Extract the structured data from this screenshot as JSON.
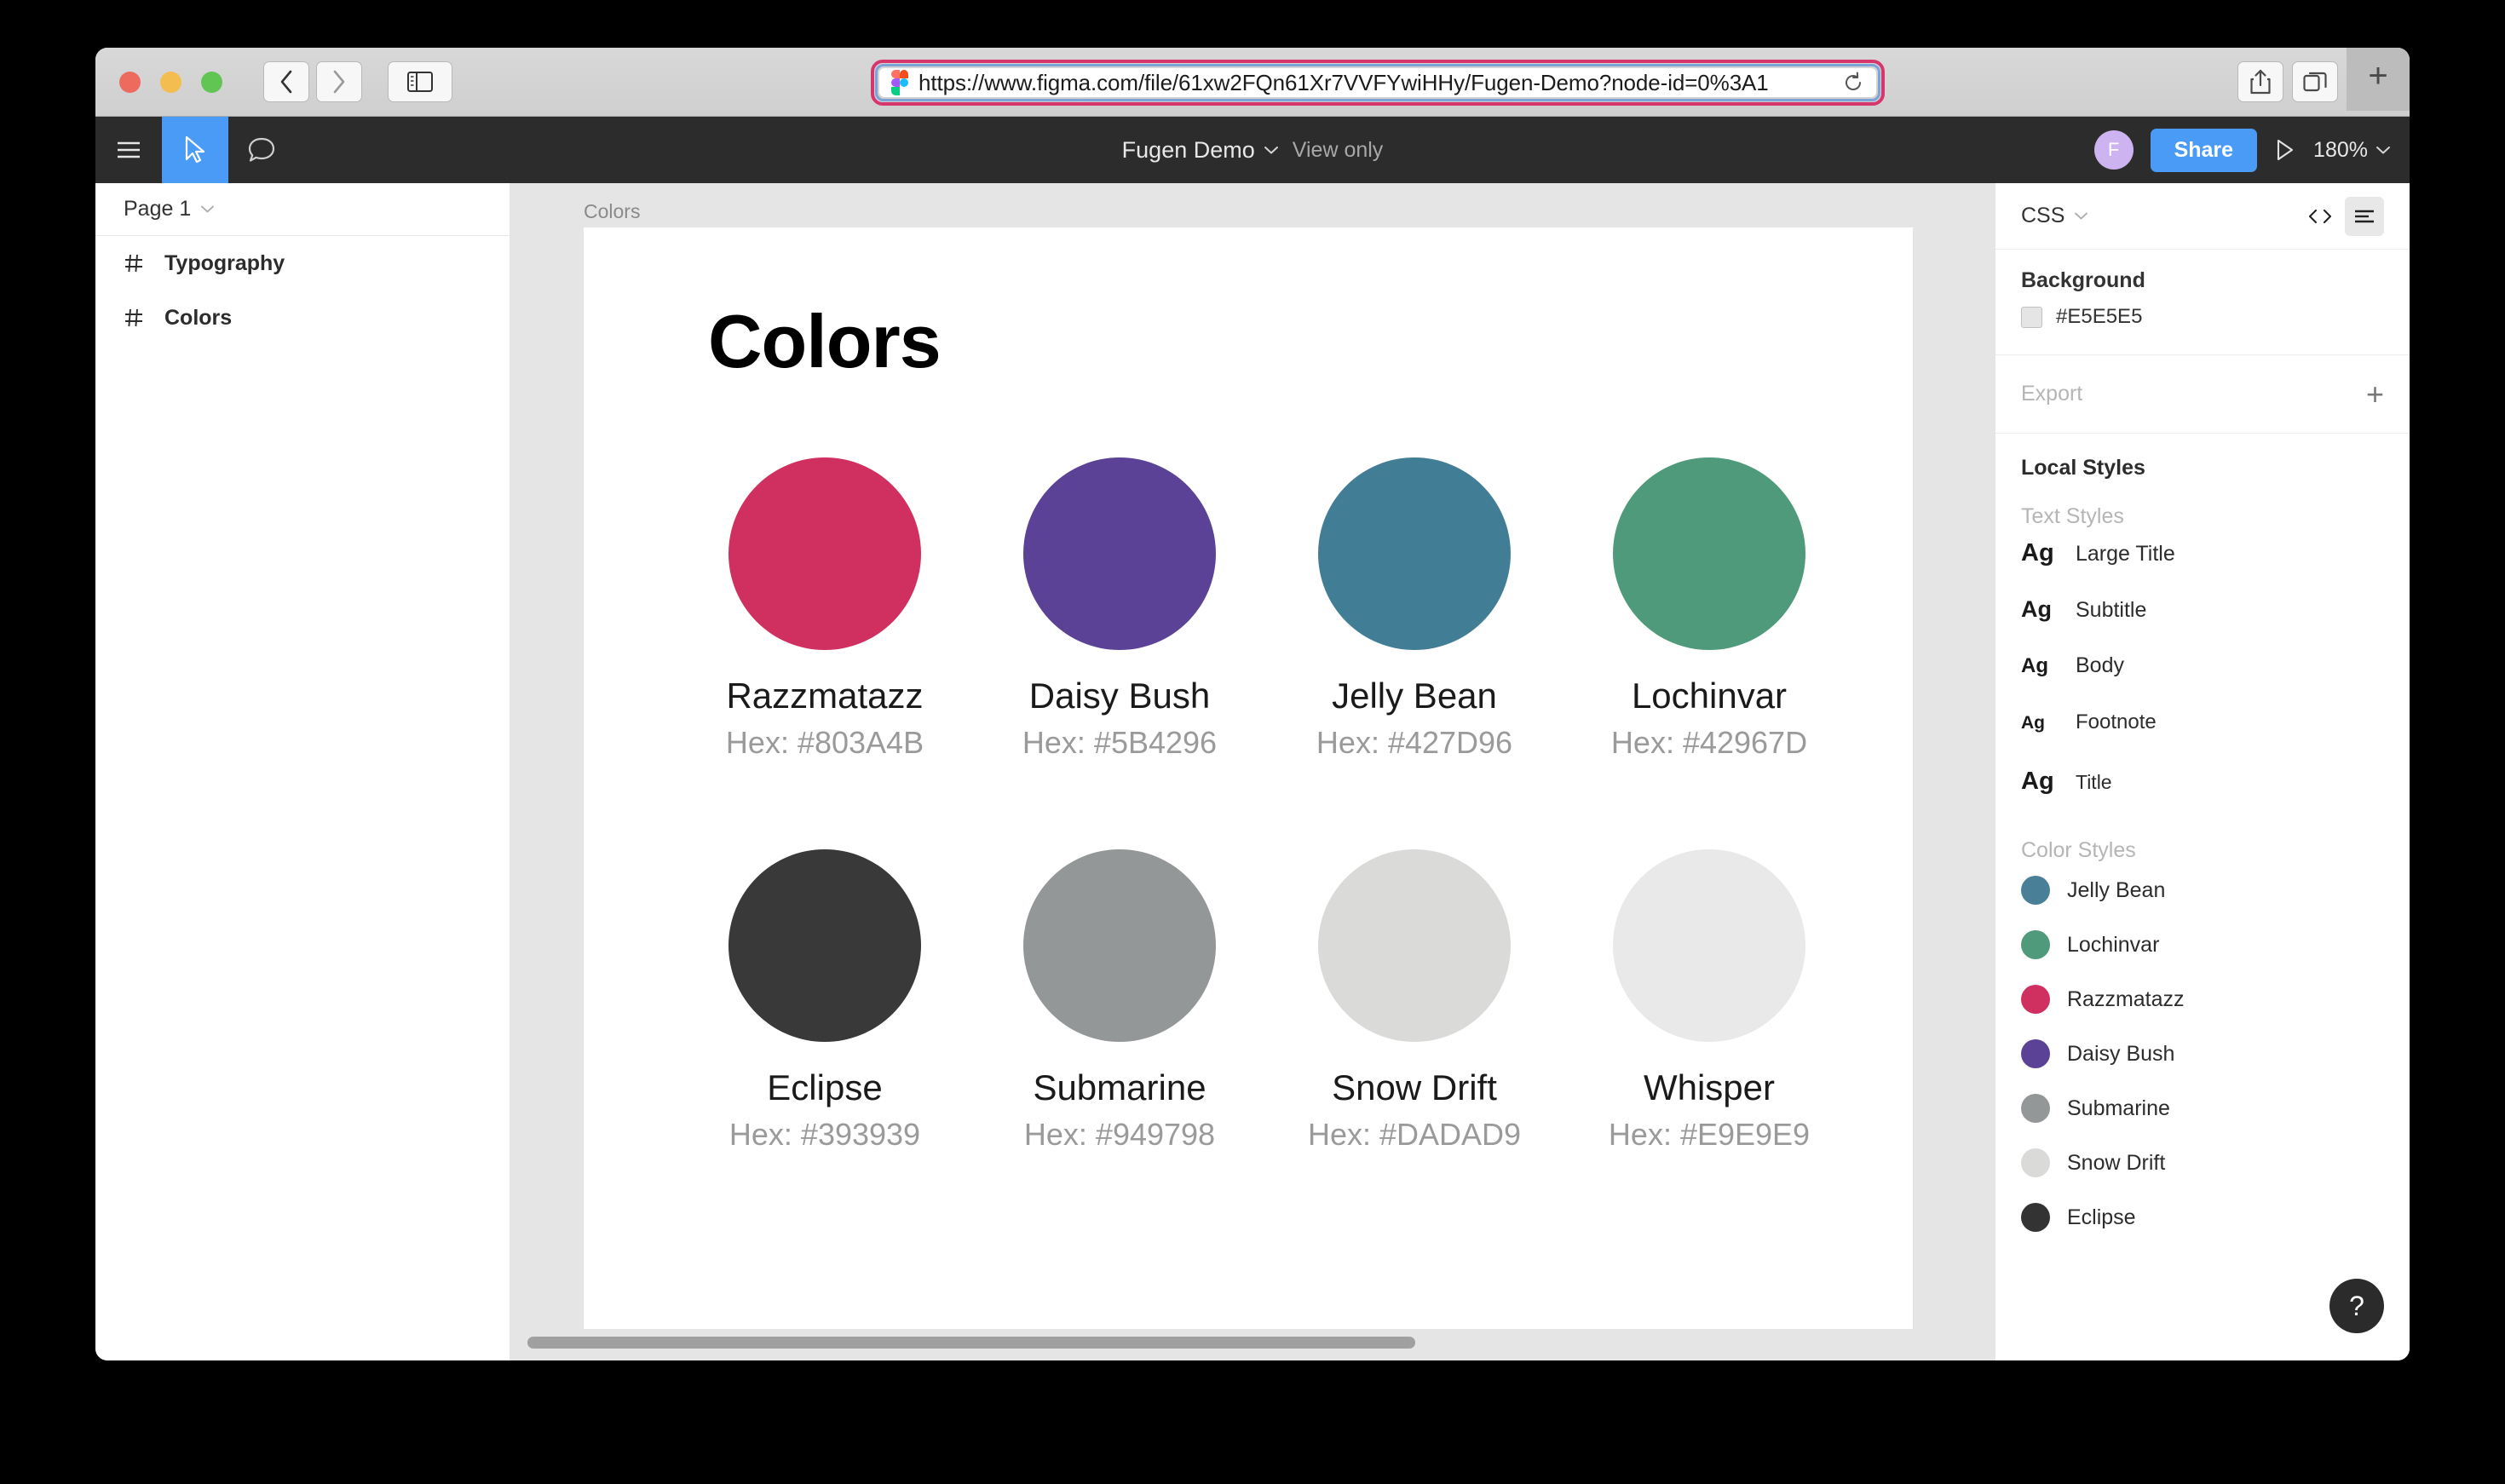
{
  "browser": {
    "url": "https://www.figma.com/file/61xw2FQn61Xr7VVFYwiHHy/Fugen-Demo?node-id=0%3A1",
    "back_icon": "chevron-left-icon",
    "forward_icon": "chevron-right-icon",
    "sidebar_icon": "sidebar-toggle-icon",
    "reload_icon": "reload-icon",
    "share_icon": "share-icon",
    "tabs_icon": "tab-overview-icon",
    "newtab_label": "+",
    "annotation": "arrow-pointing-to-url"
  },
  "toolbar": {
    "menu_icon": "hamburger-menu-icon",
    "cursor_icon": "cursor-tool-icon",
    "comment_icon": "comment-bubble-icon",
    "file_title": "Fugen Demo",
    "file_chevron": "chevron-down-icon",
    "view_mode": "View only",
    "avatar_initial": "F",
    "avatar_color": "#CDB4F0",
    "share_label": "Share",
    "share_color": "#4A9BF5",
    "present_icon": "play-present-icon",
    "zoom_level": "180%",
    "zoom_chevron": "chevron-down-icon"
  },
  "sidebar": {
    "page_name": "Page 1",
    "page_chevron": "chevron-down-icon",
    "layers": [
      {
        "icon": "frame-hash-icon",
        "label": "Typography"
      },
      {
        "icon": "frame-hash-icon",
        "label": "Colors"
      }
    ]
  },
  "canvas": {
    "frame_label": "Colors",
    "frame_title": "Colors",
    "background": "#E5E5E5",
    "swatches": [
      {
        "name": "Razzmatazz",
        "hex_label": "Hex: #803A4B",
        "render_color": "#D0305F"
      },
      {
        "name": "Daisy Bush",
        "hex_label": "Hex: #5B4296",
        "render_color": "#5B4296"
      },
      {
        "name": "Jelly Bean",
        "hex_label": "Hex: #427D96",
        "render_color": "#427D96"
      },
      {
        "name": "Lochinvar",
        "hex_label": "Hex: #42967D",
        "render_color": "#4E9A7B"
      },
      {
        "name": "Eclipse",
        "hex_label": "Hex: #393939",
        "render_color": "#393939"
      },
      {
        "name": "Submarine",
        "hex_label": "Hex: #949798",
        "render_color": "#949798"
      },
      {
        "name": "Snow Drift",
        "hex_label": "Hex: #DADAD9",
        "render_color": "#DADAD9"
      },
      {
        "name": "Whisper",
        "hex_label": "Hex: #E9E9E9",
        "render_color": "#E9E9E9"
      }
    ]
  },
  "inspect": {
    "mode": "CSS",
    "mode_chevron": "chevron-down-icon",
    "code_icon": "code-brackets-icon",
    "list_icon": "list-view-icon",
    "background_label": "Background",
    "background_hex": "#E5E5E5",
    "export_label": "Export",
    "export_add": "+",
    "local_styles_label": "Local Styles",
    "text_styles_label": "Text Styles",
    "text_styles": [
      {
        "sample": "Ag",
        "name": "Large Title",
        "sample_size": "29px",
        "name_size": "25px"
      },
      {
        "sample": "Ag",
        "name": "Subtitle",
        "sample_size": "27px",
        "name_size": "25px"
      },
      {
        "sample": "Ag",
        "name": "Body",
        "sample_size": "24px",
        "name_size": "25px"
      },
      {
        "sample": "Ag",
        "name": "Footnote",
        "sample_size": "21px",
        "name_size": "24px"
      },
      {
        "sample": "Ag",
        "name": "Title",
        "sample_size": "29px",
        "name_size": "23px"
      }
    ],
    "color_styles_label": "Color Styles",
    "color_styles": [
      {
        "name": "Jelly Bean",
        "color": "#4A7F98"
      },
      {
        "name": "Lochinvar",
        "color": "#4E9A7B"
      },
      {
        "name": "Razzmatazz",
        "color": "#D0305F"
      },
      {
        "name": "Daisy Bush",
        "color": "#5B4296"
      },
      {
        "name": "Submarine",
        "color": "#949798"
      },
      {
        "name": "Snow Drift",
        "color": "#DADAD9"
      },
      {
        "name": "Eclipse",
        "color": "#333333"
      }
    ],
    "help_label": "?"
  }
}
